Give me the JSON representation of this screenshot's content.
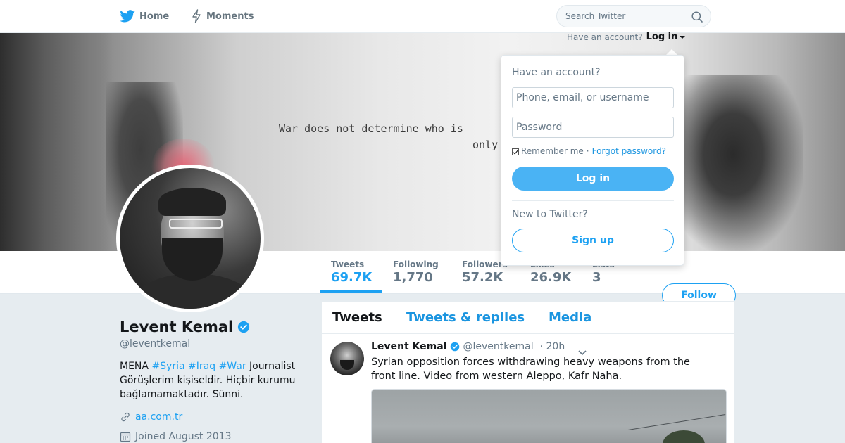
{
  "nav": {
    "home_label": "Home",
    "moments_label": "Moments",
    "search_placeholder": "Search Twitter"
  },
  "banner": {
    "line1": "War does not determine who is",
    "line2": "only"
  },
  "account": {
    "prompt": "Have an account?",
    "login_link": "Log in"
  },
  "login_dropdown": {
    "title": "Have an account?",
    "username_placeholder": "Phone, email, or username",
    "password_placeholder": "Password",
    "remember_label": "Remember me",
    "separator": "·",
    "forgot_label": "Forgot password?",
    "login_button": "Log in",
    "new_prompt": "New to Twitter?",
    "signup_button": "Sign up"
  },
  "stats": [
    {
      "label": "Tweets",
      "value": "69.7K"
    },
    {
      "label": "Following",
      "value": "1,770"
    },
    {
      "label": "Followers",
      "value": "57.2K"
    },
    {
      "label": "Likes",
      "value": "26.9K"
    },
    {
      "label": "Lists",
      "value": "3"
    }
  ],
  "follow_button": "Follow",
  "profile": {
    "name": "Levent Kemal",
    "handle": "@leventkemal",
    "bio_prefix": "MENA ",
    "bio_tags": [
      "#Syria",
      "#Iraq",
      "#War"
    ],
    "bio_suffix": " Journalist Görüşlerim kişiseldir. Hiçbir kurumu bağlamamaktadır. Sünni.",
    "website": "aa.com.tr",
    "joined": "Joined August 2013"
  },
  "timeline": {
    "tabs": [
      "Tweets",
      "Tweets & replies",
      "Media"
    ]
  },
  "tweet": {
    "name": "Levent Kemal",
    "handle": "@leventkemal",
    "time": "· 20h",
    "text": "Syrian opposition forces withdrawing heavy weapons from the front line. Video from western Aleppo, Kafr Naha."
  },
  "colors": {
    "accent": "#1da1f2",
    "login_button_bg": "#4ab3f4",
    "link": "#1b95e0",
    "muted": "#657786",
    "page_bg": "#e6ecf0"
  },
  "icons": {
    "home": "twitter-bird-icon",
    "moments": "lightning-icon",
    "search": "search-icon",
    "verified": "verified-badge-icon",
    "website": "link-icon",
    "joined": "calendar-icon",
    "tweet_menu": "chevron-down-icon"
  }
}
